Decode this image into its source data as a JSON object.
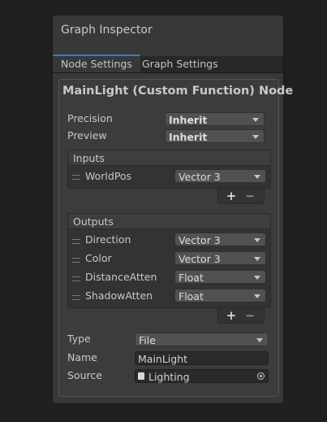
{
  "window": {
    "title": "Graph Inspector"
  },
  "tabs": [
    {
      "label": "Node Settings",
      "active": true
    },
    {
      "label": "Graph Settings",
      "active": false
    }
  ],
  "node": {
    "title": "MainLight (Custom Function) Node",
    "precision": {
      "label": "Precision",
      "value": "Inherit"
    },
    "preview": {
      "label": "Preview",
      "value": "Inherit"
    },
    "inputs": {
      "header": "Inputs",
      "items": [
        {
          "name": "WorldPos",
          "type": "Vector 3"
        }
      ],
      "add": "+",
      "remove": "−"
    },
    "outputs": {
      "header": "Outputs",
      "items": [
        {
          "name": "Direction",
          "type": "Vector 3"
        },
        {
          "name": "Color",
          "type": "Vector 3"
        },
        {
          "name": "DistanceAtten",
          "type": "Float"
        },
        {
          "name": "ShadowAtten",
          "type": "Float"
        }
      ],
      "add": "+",
      "remove": "−"
    },
    "type": {
      "label": "Type",
      "value": "File"
    },
    "name": {
      "label": "Name",
      "value": "MainLight"
    },
    "source": {
      "label": "Source",
      "value": "Lighting"
    }
  },
  "colors": {
    "accent": "#3a79bb",
    "panel": "#383838",
    "background": "#202020"
  }
}
